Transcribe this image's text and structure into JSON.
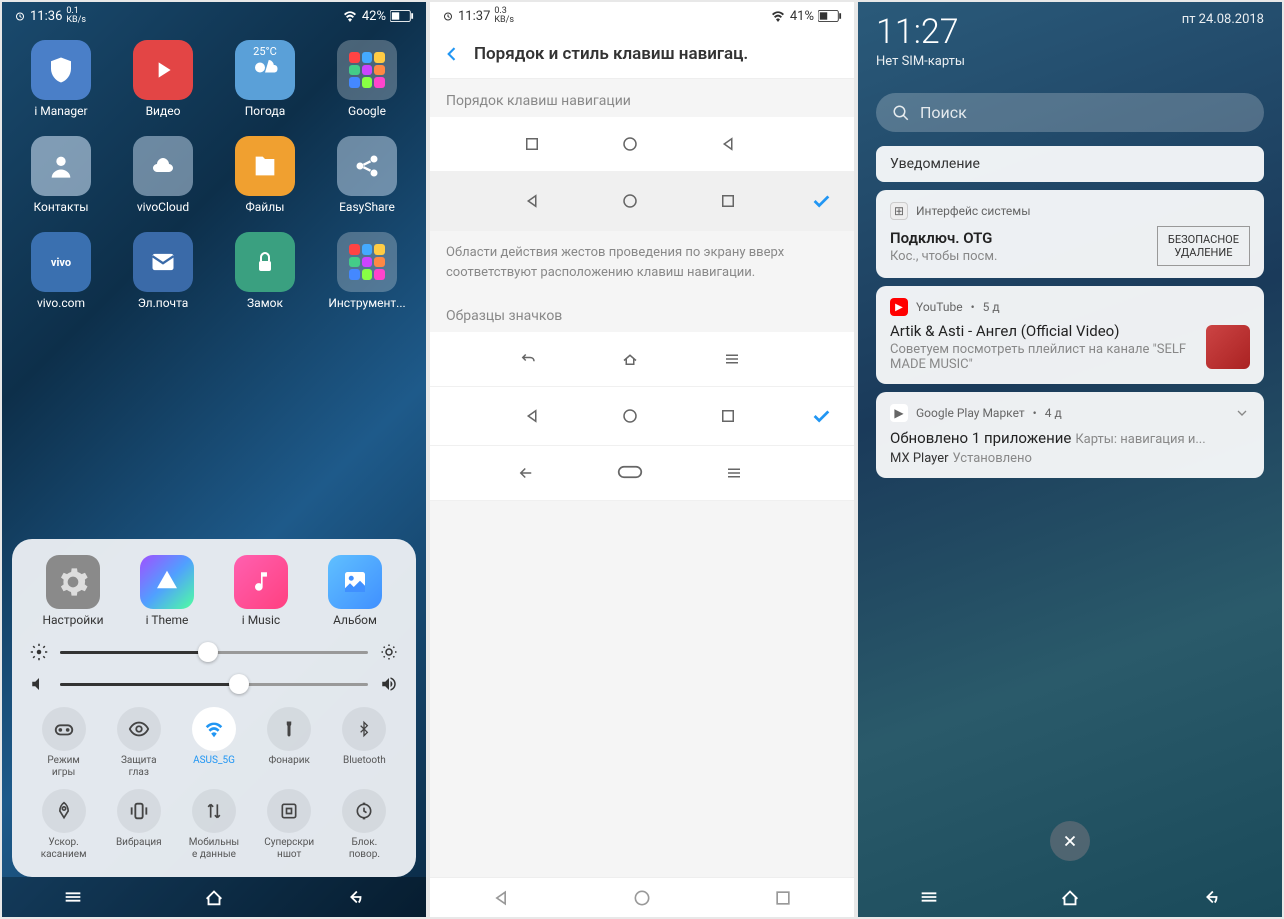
{
  "p1": {
    "status": {
      "time": "11:36",
      "speed": "0.1\nKB/s",
      "battery": "42%"
    },
    "apps": [
      {
        "label": "i Manager",
        "icon": "shield",
        "bg": "#4a7fc8"
      },
      {
        "label": "Видео",
        "icon": "play",
        "bg": "#e34545"
      },
      {
        "label": "Погода",
        "icon": "weather",
        "bg": "#5aa0d8",
        "temp": "25°C"
      },
      {
        "label": "Google",
        "icon": "folder",
        "bg": "rgba(255,255,255,0.25)"
      },
      {
        "label": "Контакты",
        "icon": "contact",
        "bg": "rgba(200,220,240,0.6)"
      },
      {
        "label": "vivoCloud",
        "icon": "cloud",
        "bg": "rgba(200,220,240,0.5)"
      },
      {
        "label": "Файлы",
        "icon": "files",
        "bg": "#f0a030"
      },
      {
        "label": "EasyShare",
        "icon": "share",
        "bg": "rgba(200,220,240,0.5)"
      },
      {
        "label": "vivo.com",
        "icon": "vivo",
        "bg": "#3a70b0"
      },
      {
        "label": "Эл.почта",
        "icon": "mail",
        "bg": "#3a6aa8"
      },
      {
        "label": "Замок",
        "icon": "lock",
        "bg": "#3aa080"
      },
      {
        "label": "Инструмент...",
        "icon": "folder",
        "bg": "rgba(255,255,255,0.25)"
      }
    ],
    "panel_apps": [
      {
        "label": "Настройки",
        "icon": "gear",
        "bg": "#8a8a8a"
      },
      {
        "label": "i Theme",
        "icon": "prism",
        "bg": "linear-gradient(135deg,#a050ff,#50a0ff,#50ffa0)"
      },
      {
        "label": "i Music",
        "icon": "music",
        "bg": "linear-gradient(135deg,#ff60b0,#ff4080)"
      },
      {
        "label": "Альбом",
        "icon": "album",
        "bg": "linear-gradient(135deg,#60c0ff,#4090ff)"
      }
    ],
    "brightness": 48,
    "volume": 58,
    "toggles": [
      {
        "label": "Режим\nигры",
        "icon": "game"
      },
      {
        "label": "Защита\nглаз",
        "icon": "eye"
      },
      {
        "label": "ASUS_5G",
        "icon": "wifi",
        "active": true
      },
      {
        "label": "Фонарик",
        "icon": "torch"
      },
      {
        "label": "Bluetooth",
        "icon": "bt"
      },
      {
        "label": "Ускор.\nкасанием",
        "icon": "rocket"
      },
      {
        "label": "Вибрация",
        "icon": "vibrate"
      },
      {
        "label": "Мобильны\nе данные",
        "icon": "data"
      },
      {
        "label": "Суперскри\nншот",
        "icon": "screenshot"
      },
      {
        "label": "Блок.\nповор.",
        "icon": "rotation"
      }
    ]
  },
  "p2": {
    "status": {
      "time": "11:37",
      "speed": "0.3\nKB/s",
      "battery": "41%"
    },
    "title": "Порядок и стиль клавиш навигац.",
    "section1": "Порядок клавиш навигации",
    "desc": "Области действия жестов проведения по экрану вверх соответствуют расположению клавиш навигации.",
    "section2": "Образцы значков"
  },
  "p3": {
    "time": "11:27",
    "date": "пт 24.08.2018",
    "sim": "Нет SIM-карты",
    "search": "Поиск",
    "notif_header": "Уведомление",
    "cards": [
      {
        "app": "Интерфейс системы",
        "title": "Подключ. OTG",
        "sub": "Кос., чтобы посм.",
        "action": "БЕЗОПАСНОЕ\nУДАЛЕНИЕ"
      },
      {
        "app": "YouTube",
        "age": "5 д",
        "title": "Artik & Asti - Ангел (Official Video)",
        "sub": "Советуем посмотреть плейлист на канале \"SELF MADE MUSIC\""
      },
      {
        "app": "Google Play Маркет",
        "age": "4 д",
        "title": "Обновлено 1 приложение",
        "title_extra": "Карты: навигация и...",
        "sub": "MX Player",
        "sub_extra": "Установлено"
      }
    ]
  }
}
